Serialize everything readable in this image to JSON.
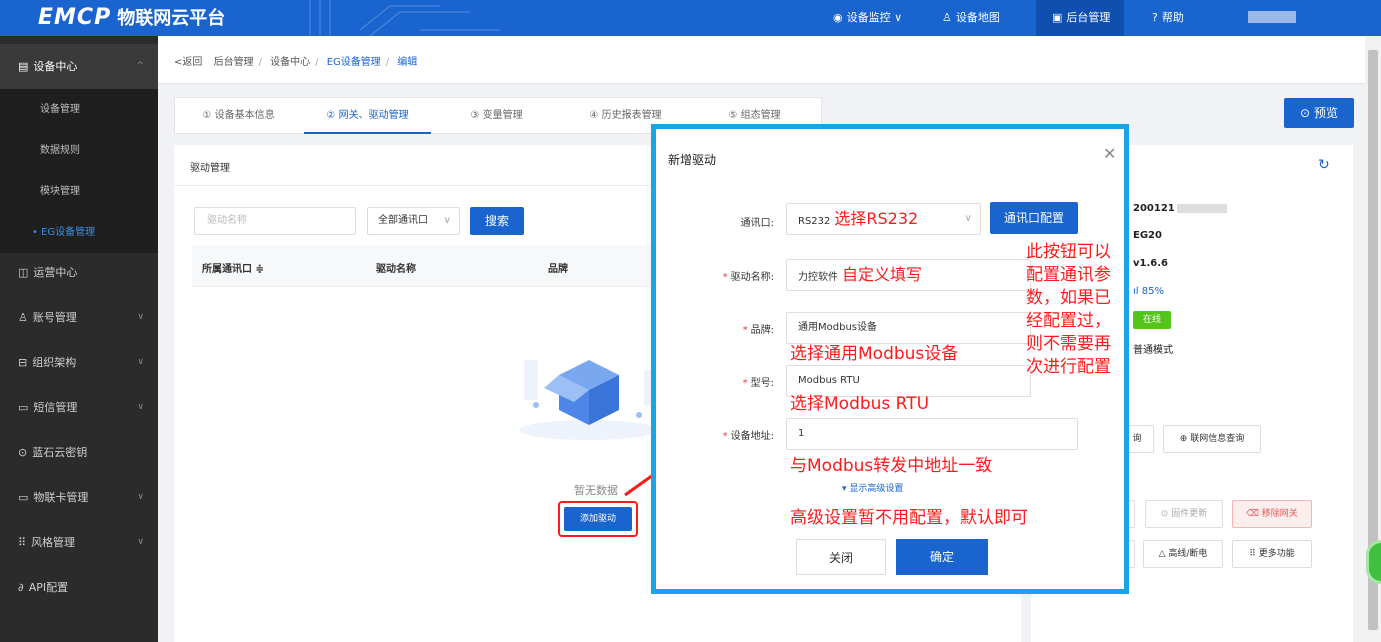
{
  "topbar": {
    "brand": "EMCP",
    "brand_cn": "物联网云平台",
    "nav": [
      {
        "label": "设备监控",
        "icon": "monitor-icon",
        "suffix": "∨"
      },
      {
        "label": "设备地图",
        "icon": "map-pin-icon"
      },
      {
        "label": "后台管理",
        "icon": "admin-icon"
      },
      {
        "label": "帮助",
        "icon": "help-icon"
      }
    ]
  },
  "sidebar": {
    "top": "设备中心",
    "subs": [
      "设备管理",
      "数据规则",
      "模块管理",
      "EG设备管理"
    ],
    "items": [
      "运营中心",
      "账号管理",
      "组织架构",
      "短信管理",
      "蓝石云密钥",
      "物联卡管理",
      "风格管理",
      "API配置"
    ]
  },
  "breadcrumb": {
    "back": "返回",
    "items": [
      "后台管理",
      "设备中心",
      "EG设备管理",
      "编辑"
    ]
  },
  "tabs": [
    "① 设备基本信息",
    "② 网关、驱动管理",
    "③ 变量管理",
    "④ 历史报表管理",
    "⑤ 组态管理"
  ],
  "preview_label": "预览",
  "panel": {
    "title": "驱动管理",
    "search_placeholder": "驱动名称",
    "port_select": "全部通讯口",
    "search_label": "搜索",
    "columns": [
      "所属通讯口 ≑",
      "驱动名称",
      "品牌"
    ],
    "empty_text": "暂无数据",
    "add_label": "添加驱动"
  },
  "right": {
    "serial": "200121",
    "model": "EG20",
    "version": "v1.6.6",
    "signal": "85%",
    "status": "在线",
    "mode": "普通模式",
    "buttons": [
      "询",
      "联网信息查询",
      "固件更新",
      "移除网关",
      "高线/断电",
      "更多功能"
    ]
  },
  "modal": {
    "title": "新增驱动",
    "port_label": "通讯口:",
    "port_value": "RS232",
    "port_note": "选择RS232",
    "port_btn": "通讯口配置",
    "name_label": "驱动名称:",
    "name_value": "力控软件",
    "name_note": "自定义填写",
    "brand_label": "品牌:",
    "brand_value": "通用Modbus设备",
    "brand_note": "选择通用Modbus设备",
    "model_label": "型号:",
    "model_value": "Modbus RTU",
    "model_note": "选择Modbus RTU",
    "addr_label": "设备地址:",
    "addr_value": "1",
    "addr_note": "与Modbus转发中地址一致",
    "adv_link": "▾ 显示高级设置",
    "adv_note": "高级设置暂不用配置，默认即可",
    "btn_note": [
      "此按钮可以",
      "配置通讯参",
      "数，如果已",
      "经配置过，",
      "则不需要再",
      "次进行配置"
    ],
    "close_label": "关闭",
    "ok_label": "确定"
  },
  "colors": {
    "primary": "#1a64d0",
    "annotation": "#ff1a1a",
    "frame": "#1aa4e8",
    "sidebar": "#2b2b2b"
  }
}
